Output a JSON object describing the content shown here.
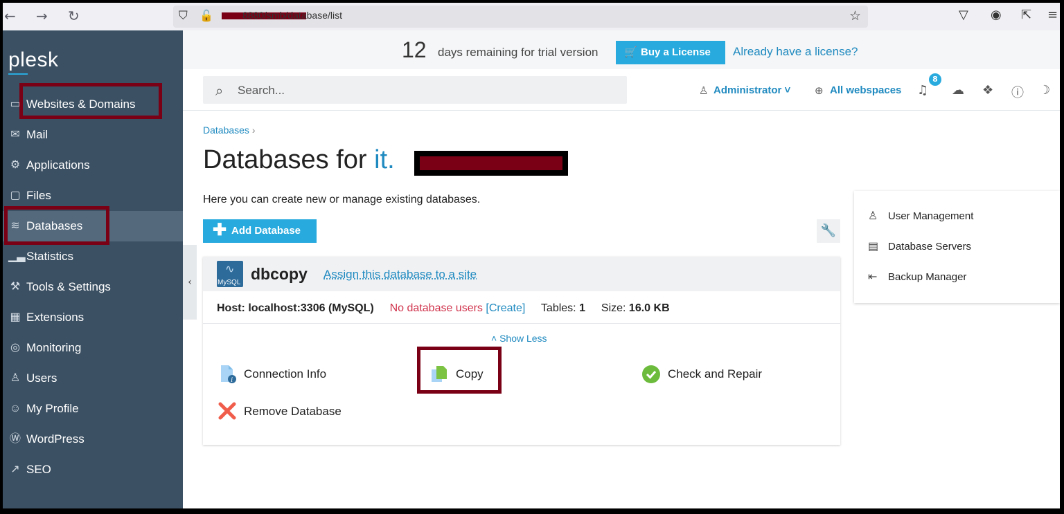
{
  "browser": {
    "url_visible": "8880/smb/database/list",
    "icons": [
      "back-icon",
      "forward-icon",
      "reload-icon",
      "shield-icon",
      "lock-off-icon",
      "star-icon",
      "pocket-icon",
      "account-icon",
      "extensions-icon",
      "menu-icon"
    ]
  },
  "sidebar": {
    "logo": "plesk",
    "items": [
      {
        "label": "Websites & Domains",
        "icon": "monitor-icon"
      },
      {
        "label": "Mail",
        "icon": "mail-icon"
      },
      {
        "label": "Applications",
        "icon": "gear-icon"
      },
      {
        "label": "Files",
        "icon": "folder-icon"
      },
      {
        "label": "Databases",
        "icon": "database-icon",
        "active": true
      },
      {
        "label": "Statistics",
        "icon": "chart-icon"
      },
      {
        "label": "Tools & Settings",
        "icon": "tools-icon"
      },
      {
        "label": "Extensions",
        "icon": "extensions-icon"
      },
      {
        "label": "Monitoring",
        "icon": "monitoring-icon"
      },
      {
        "label": "Users",
        "icon": "user-icon"
      },
      {
        "label": "My Profile",
        "icon": "profile-icon"
      },
      {
        "label": "WordPress",
        "icon": "wordpress-icon"
      },
      {
        "label": "SEO",
        "icon": "seo-icon"
      }
    ]
  },
  "trial": {
    "days": "12",
    "text": "days remaining for trial version",
    "buy_label": "Buy a License",
    "have_license": "Already have a license?"
  },
  "header": {
    "search_placeholder": "Search...",
    "user": "Administrator",
    "webspaces": "All webspaces",
    "notification_count": "8"
  },
  "main": {
    "breadcrumb": "Databases",
    "title_prefix": "Databases for",
    "title_domain": "it.",
    "description": "Here you can create new or manage existing databases.",
    "add_button": "Add Database"
  },
  "database": {
    "logo_text": "MySQL",
    "name": "dbcopy",
    "assign_link": "Assign this database to a site",
    "host_label": "Host:",
    "host_value": "localhost:3306 (MySQL)",
    "users_text": "No database users",
    "create_link": "[Create]",
    "tables_label": "Tables:",
    "tables_value": "1",
    "size_label": "Size:",
    "size_value": "16.0 KB",
    "show_less": "Show Less",
    "actions": {
      "connection_info": "Connection Info",
      "copy": "Copy",
      "check_repair": "Check and Repair",
      "remove": "Remove Database"
    }
  },
  "right_panel": {
    "items": [
      {
        "label": "User Management",
        "icon": "user-management-icon"
      },
      {
        "label": "Database Servers",
        "icon": "server-icon"
      },
      {
        "label": "Backup Manager",
        "icon": "backup-icon"
      }
    ]
  },
  "colors": {
    "accent": "#28aade",
    "link": "#1f8ac0",
    "sidebar": "#3b5063",
    "highlight": "#7a0016",
    "warning": "#d0344d"
  }
}
